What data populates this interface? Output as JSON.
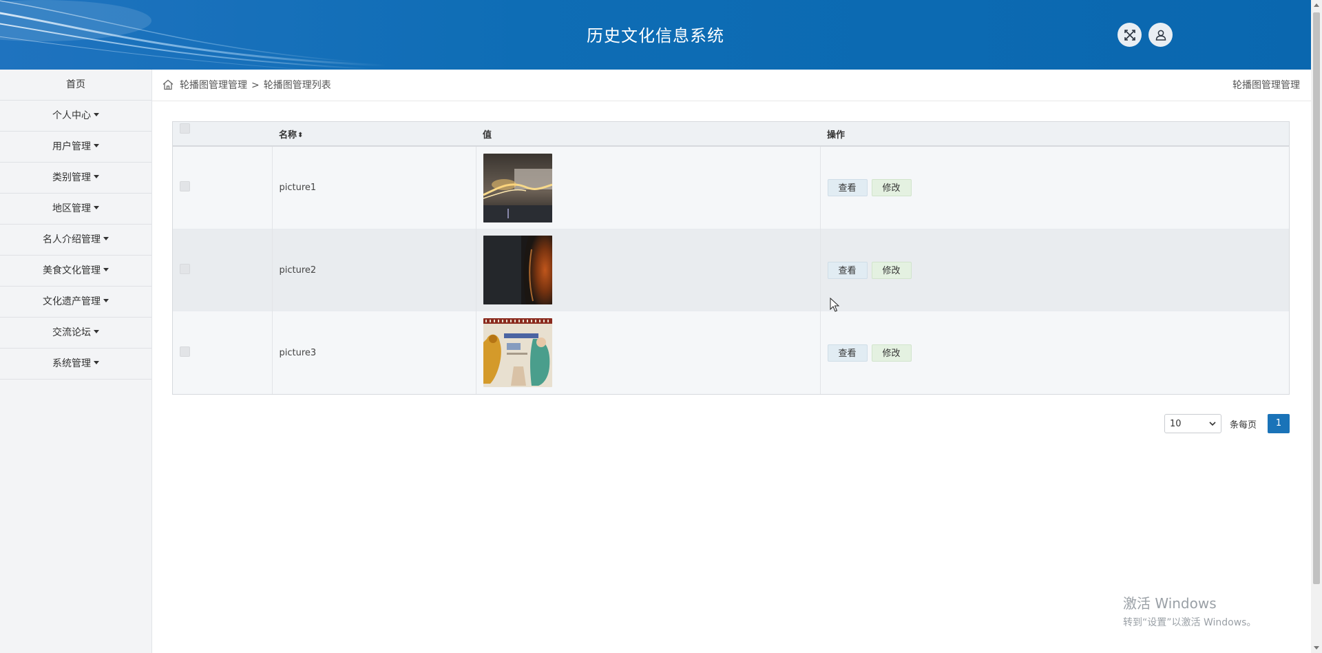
{
  "header": {
    "title": "历史文化信息系统",
    "fullscreen_icon": "expand-icon",
    "user_icon": "user-icon"
  },
  "sidebar": {
    "items": [
      {
        "label": "首页",
        "has_caret": false
      },
      {
        "label": "个人中心",
        "has_caret": true
      },
      {
        "label": "用户管理",
        "has_caret": true
      },
      {
        "label": "类别管理",
        "has_caret": true
      },
      {
        "label": "地区管理",
        "has_caret": true
      },
      {
        "label": "名人介绍管理",
        "has_caret": true
      },
      {
        "label": "美食文化管理",
        "has_caret": true
      },
      {
        "label": "文化遗产管理",
        "has_caret": true
      },
      {
        "label": "交流论坛",
        "has_caret": true
      },
      {
        "label": "系统管理",
        "has_caret": true
      }
    ]
  },
  "breadcrumb": {
    "home_icon": "home-icon",
    "level1": "轮播图管理管理",
    "separator": ">",
    "level2": "轮播图管理列表",
    "right_title": "轮播图管理管理"
  },
  "table": {
    "columns": {
      "name": "名称",
      "value": "值",
      "action": "操作"
    },
    "rows": [
      {
        "name": "picture1",
        "image": "exhibition-hall-light-image"
      },
      {
        "name": "picture2",
        "image": "amber-vase-image"
      },
      {
        "name": "picture3",
        "image": "cultural-heritage-poster-image"
      }
    ],
    "view_label": "查看",
    "edit_label": "修改"
  },
  "pagination": {
    "page_size": "10",
    "per_page_label": "条每页",
    "current_page": "1"
  },
  "watermark": {
    "line1": "激活 Windows",
    "line2": "转到“设置”以激活 Windows。"
  },
  "colors": {
    "header_bg": "#0e6db5",
    "sidebar_bg": "#f3f4f6",
    "page_active": "#1a73b8"
  }
}
